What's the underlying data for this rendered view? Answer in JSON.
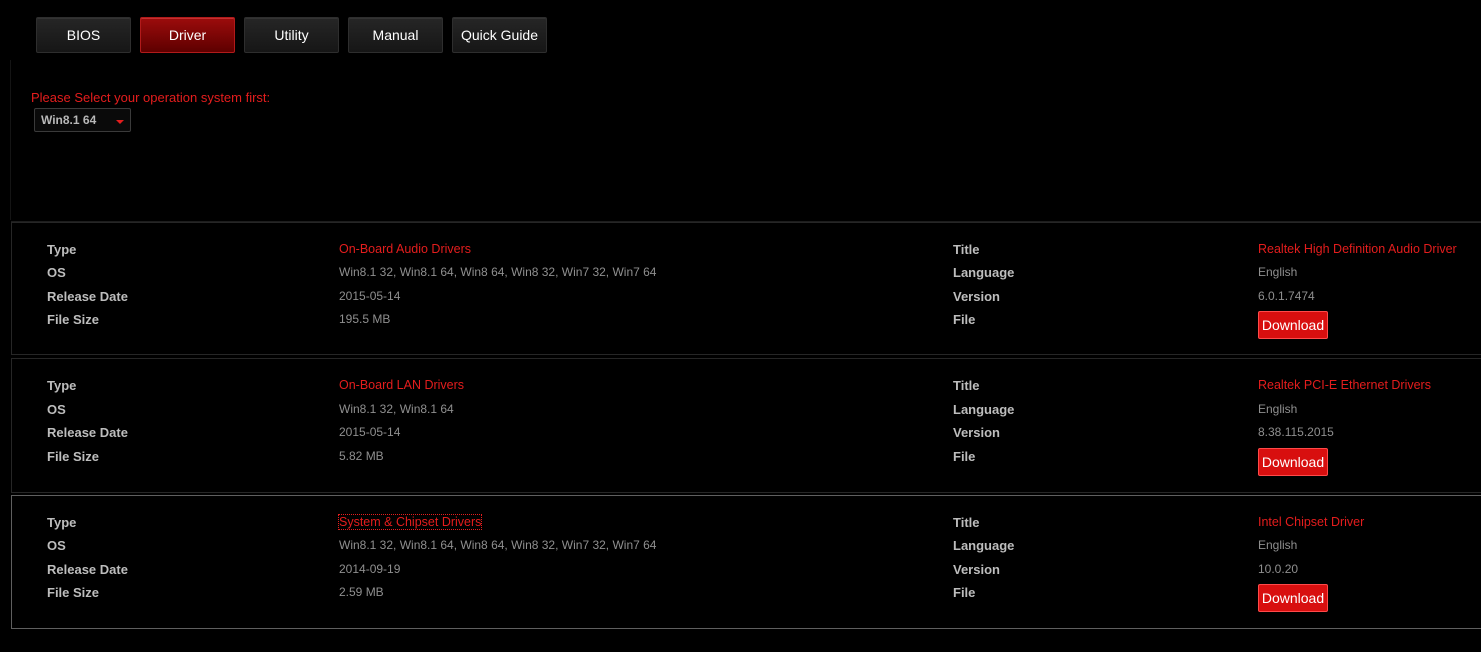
{
  "tabs": [
    {
      "label": "BIOS",
      "active": false
    },
    {
      "label": "Driver",
      "active": true
    },
    {
      "label": "Utility",
      "active": false
    },
    {
      "label": "Manual",
      "active": false
    },
    {
      "label": "Quick Guide",
      "active": false
    }
  ],
  "os_selector": {
    "prompt": "Please Select your operation system first:",
    "selected": "Win8.1 64"
  },
  "field_labels": {
    "type": "Type",
    "os": "OS",
    "release_date": "Release Date",
    "file_size": "File Size",
    "title": "Title",
    "language": "Language",
    "version": "Version",
    "file": "File"
  },
  "drivers": [
    {
      "type": "On-Board Audio Drivers",
      "os": "Win8.1 32, Win8.1 64, Win8 64, Win8 32, Win7 32, Win7 64",
      "release_date": "2015-05-14",
      "file_size": "195.5 MB",
      "title": "Realtek High Definition Audio Driver",
      "language": "English",
      "version": "6.0.1.7474",
      "download_label": "Download"
    },
    {
      "type": "On-Board LAN Drivers",
      "os": "Win8.1 32, Win8.1 64",
      "release_date": "2015-05-14",
      "file_size": "5.82 MB",
      "title": "Realtek PCI-E Ethernet Drivers",
      "language": "English",
      "version": "8.38.115.2015",
      "download_label": "Download"
    },
    {
      "type": "System & Chipset Drivers",
      "os": "Win8.1 32, Win8.1 64, Win8 64, Win8 32, Win7 32, Win7 64",
      "release_date": "2014-09-19",
      "file_size": "2.59 MB",
      "title": "Intel Chipset Driver",
      "language": "English",
      "version": "10.0.20",
      "download_label": "Download"
    }
  ],
  "colors": {
    "background": "#000000",
    "accent_red": "#e41d1d",
    "button_red": "#d80f0f",
    "label_text": "#bdbdbd",
    "value_text": "#8f8f8f"
  }
}
